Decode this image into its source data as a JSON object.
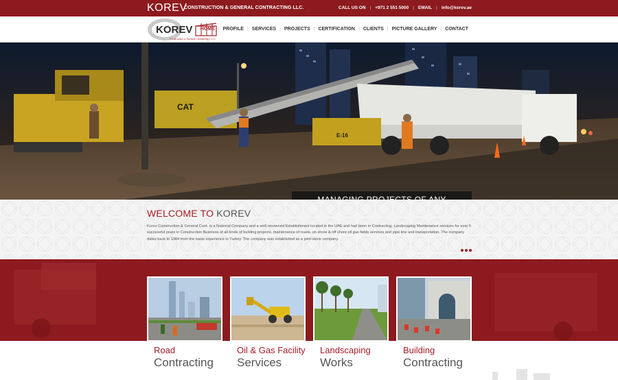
{
  "topbar": {
    "brand": "KOREV",
    "tagline": "CONSTRUCTION & GENERAL CONTRACTING LLC.",
    "call_label": "CALL US ON",
    "phone": "+971 2 551 5000",
    "email_label": "EMAIL",
    "email": "info@korev.ae"
  },
  "logo": {
    "text": "KOREV",
    "subtext": "Construction & General Contracting L.L.C."
  },
  "nav": {
    "items": [
      "HOME",
      "PROFILE",
      "SERVICES",
      "PROJECTS",
      "CERTIFICATION",
      "CLIENTS",
      "PICTURE GALLERY",
      "CONTACT"
    ],
    "active": "HOME"
  },
  "hero": {
    "caption": "MANAGING PROJECTS OF ANY COMPLEXITY"
  },
  "welcome": {
    "title_main": "WELCOME TO ",
    "title_highlight": "KOREV",
    "body": "Korev Construction & General Cont. is a National Company and a well renowned Establishment located in the UAE and had been in Contracting, Landscaping Maintenance services for over 5 successful years in Construction Business of all kinds of building projects, maintenance of roads, on shore & off shore oil gas fields services and pipe line and transportation. The company dates back to 1984 from the basis experience in Turkey. The company was established as a joint-stock company."
  },
  "services": [
    {
      "title": "Road",
      "subtitle": "Contracting"
    },
    {
      "title": "Oil & Gas Facility",
      "subtitle": "Services"
    },
    {
      "title": "Landscaping",
      "subtitle": "Works"
    },
    {
      "title": "Building",
      "subtitle": "Contracting"
    }
  ],
  "colors": {
    "brand_red": "#8c1a1f",
    "accent_red": "#a31d24",
    "text_grey": "#555555"
  }
}
